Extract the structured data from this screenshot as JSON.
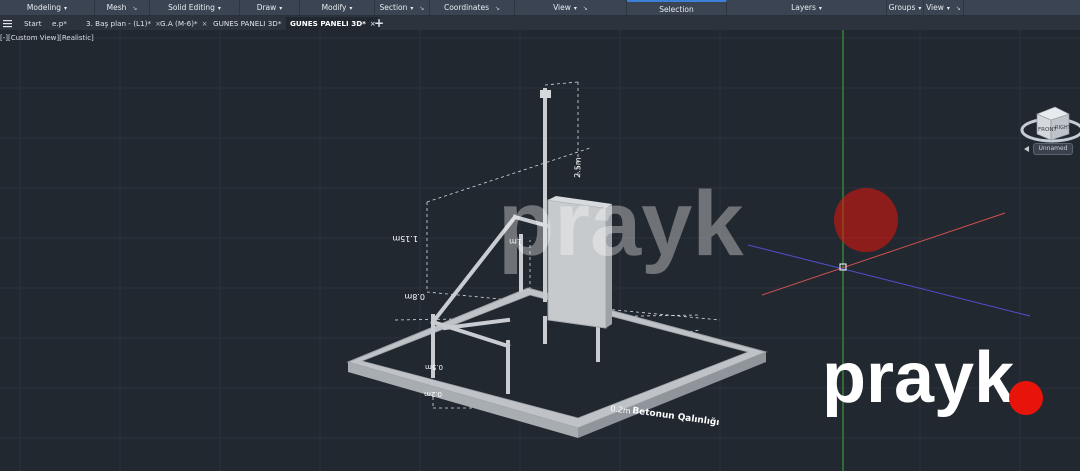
{
  "ribbon": {
    "panels": [
      {
        "label": "Modeling",
        "caret": "▾",
        "pin": ""
      },
      {
        "label": "Mesh",
        "caret": "",
        "pin": "↘"
      },
      {
        "label": "Solid Editing",
        "caret": "▾",
        "pin": ""
      },
      {
        "label": "Draw",
        "caret": "▾",
        "pin": ""
      },
      {
        "label": "Modify",
        "caret": "▾",
        "pin": ""
      },
      {
        "label": "Section",
        "caret": "▾",
        "pin": "↘"
      },
      {
        "label": "Coordinates",
        "caret": "",
        "pin": "↘"
      },
      {
        "label": "View",
        "caret": "▾",
        "pin": "↘"
      },
      {
        "label": "Selection",
        "caret": "",
        "pin": ""
      },
      {
        "label": "Layers",
        "caret": "▾",
        "pin": ""
      },
      {
        "label": "Groups",
        "caret": "▾",
        "pin": ""
      },
      {
        "label": "View",
        "caret": "▾",
        "pin": "↘"
      }
    ]
  },
  "tabs": {
    "menu_icon": "hamburger-menu-icon",
    "items": [
      {
        "label": "Start",
        "close": ""
      },
      {
        "label": "e.p*",
        "close": ""
      },
      {
        "label": "3. Baş plan - (L1)*",
        "close": "×"
      },
      {
        "label": "G.A (M-6)*",
        "close": "×"
      },
      {
        "label": "GUNES PANELI 3D*",
        "close": "×"
      },
      {
        "label": "GUNES PANELI 3D*",
        "close": "×",
        "active": true
      }
    ],
    "add_icon": "plus-icon",
    "add_label": "+"
  },
  "viewport": {
    "view_label": "[-][Custom View][Realistic]",
    "viewcube": {
      "front": "FRONT",
      "right": "RIGHT"
    },
    "ucs_name": "Unnamed"
  },
  "drawing": {
    "dimensions": {
      "top_height": "2.5m",
      "side_height": "1.15m",
      "mid_height": "1m",
      "lower_height": "0.8m",
      "base_small": "0.5m",
      "base_small2": "0.2m",
      "slab": "0.2m"
    },
    "annotation": "Betonun Qalınlığı",
    "axis_colors": {
      "x": "#d05050",
      "y": "#3ab03a",
      "z": "#5050d0"
    }
  },
  "watermark": {
    "text": "prayk",
    "dot_color": "#e8140a"
  }
}
